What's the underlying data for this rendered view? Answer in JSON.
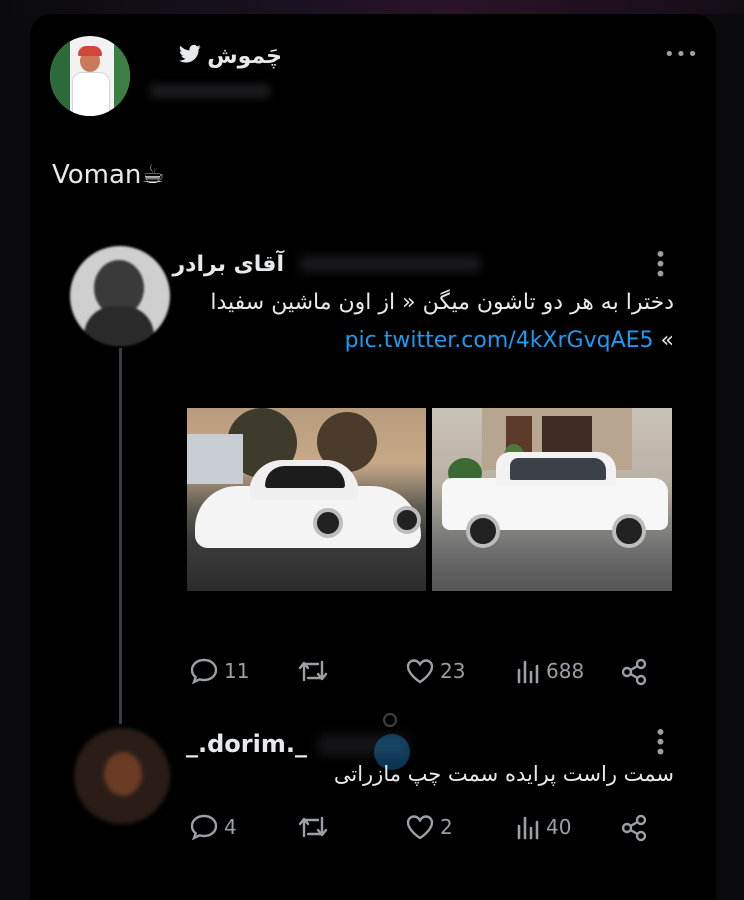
{
  "author": {
    "name": "چَموش",
    "verified_icon": "bird-icon",
    "menu_icon": "more-horizontal-icon"
  },
  "tweet": {
    "text": "Voman☕"
  },
  "quoted": {
    "name": "آقای برادر",
    "text_line1": "دخترا به هر دو تاشون میگن « از اون ماشین سفیدا",
    "link": "pic.twitter.com/4kXrGvqAE5",
    "text_line2_suffix": "»",
    "images": [
      {
        "name": "white-supra-photo"
      },
      {
        "name": "white-pride-photo"
      }
    ],
    "stats": {
      "replies": "11",
      "retweets": "",
      "likes": "23",
      "views": "688"
    }
  },
  "reply": {
    "name": "_.dorim._",
    "text": "سمت راست پرایده سمت چپ مازراتی",
    "stats": {
      "replies": "4",
      "retweets": "",
      "likes": "2",
      "views": "40"
    }
  },
  "colors": {
    "background": "#000000",
    "text": "#e7e9ea",
    "muted": "#9aa0a6",
    "link": "#1d9bf0"
  }
}
